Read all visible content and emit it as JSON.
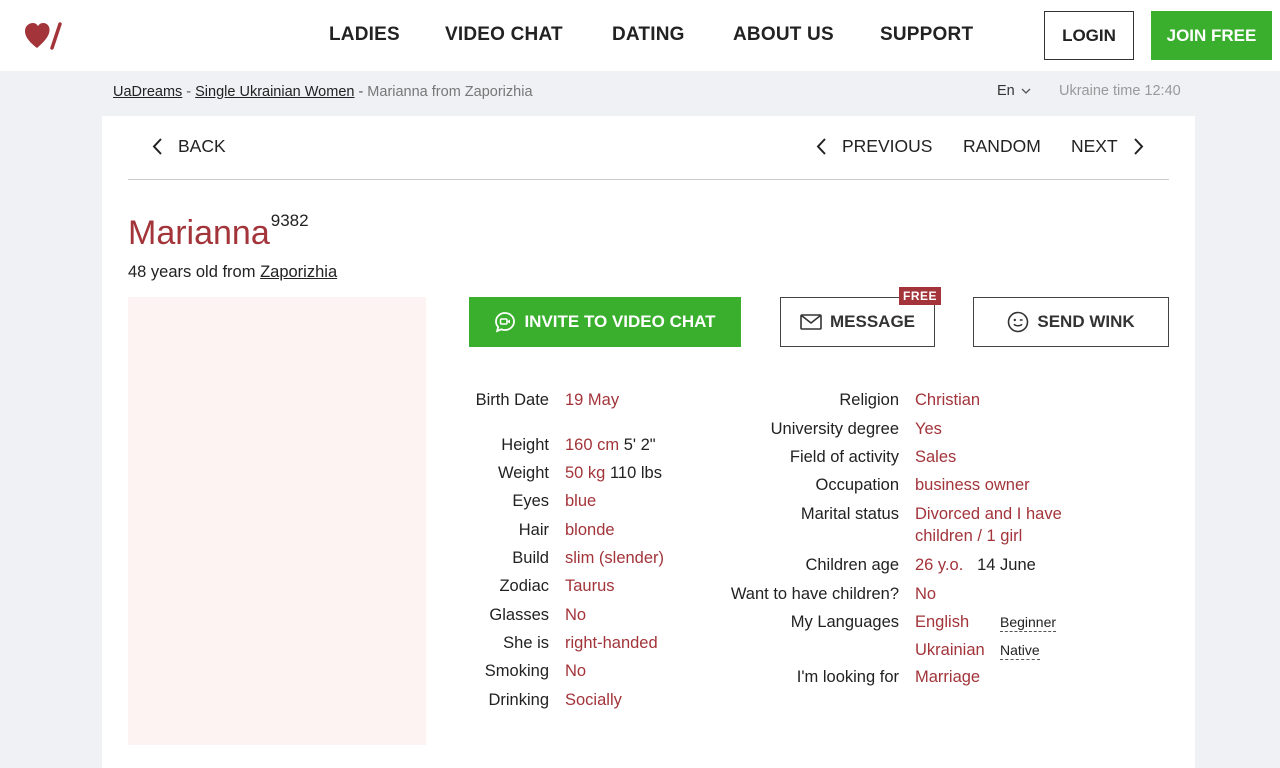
{
  "brand": {
    "logo_icon": "heart-slash-logo-icon",
    "color": "#a2343a"
  },
  "nav": {
    "items": [
      "LADIES",
      "VIDEO CHAT",
      "DATING",
      "ABOUT US",
      "SUPPORT"
    ],
    "login": "LOGIN",
    "join": "JOIN FREE"
  },
  "breadcrumb": {
    "home": "UaDreams",
    "sep": "-",
    "section": "Single Ukrainian Women",
    "current": "Marianna from Zaporizhia"
  },
  "locale": {
    "lang": "En",
    "time": "Ukraine time 12:40"
  },
  "profile_nav": {
    "back": "BACK",
    "previous": "PREVIOUS",
    "random": "RANDOM",
    "next": "NEXT"
  },
  "profile": {
    "name": "Marianna",
    "id": "9382",
    "age_text": "48 years old from",
    "city": "Zaporizhia"
  },
  "actions": {
    "video_chat": "INVITE TO VIDEO CHAT",
    "message": "MESSAGE",
    "free_badge": "FREE",
    "wink": "SEND WINK",
    "accent_green": "#3aaf2e"
  },
  "details_left": [
    {
      "label": "Birth Date",
      "value": "19 May",
      "extra": ""
    },
    {
      "label": "Height",
      "value": "160 cm",
      "extra": "5' 2\""
    },
    {
      "label": "Weight",
      "value": "50 kg",
      "extra": "110 lbs"
    },
    {
      "label": "Eyes",
      "value": "blue",
      "extra": ""
    },
    {
      "label": "Hair",
      "value": "blonde",
      "extra": ""
    },
    {
      "label": "Build",
      "value": "slim (slender)",
      "extra": ""
    },
    {
      "label": "Zodiac",
      "value": "Taurus",
      "extra": ""
    },
    {
      "label": "Glasses",
      "value": "No",
      "extra": ""
    },
    {
      "label": "She is",
      "value": "right-handed",
      "extra": ""
    },
    {
      "label": "Smoking",
      "value": "No",
      "extra": ""
    },
    {
      "label": "Drinking",
      "value": "Socially",
      "extra": ""
    }
  ],
  "details_right": {
    "religion": {
      "label": "Religion",
      "value": "Christian"
    },
    "university": {
      "label": "University degree",
      "value": "Yes"
    },
    "field": {
      "label": "Field of activity",
      "value": "Sales"
    },
    "occupation": {
      "label": "Occupation",
      "value": "business owner"
    },
    "marital": {
      "label": "Marital status",
      "value_line1": "Divorced and I have",
      "value_line2": "children / 1 girl"
    },
    "children_age": {
      "label": "Children age",
      "value": "26 y.o.",
      "extra": "14 June"
    },
    "want_children": {
      "label": "Want to have children?",
      "value": "No"
    },
    "languages": {
      "label": "My Languages",
      "items": [
        {
          "name": "English",
          "level": "Beginner"
        },
        {
          "name": "Ukrainian",
          "level": "Native"
        }
      ]
    },
    "looking_for": {
      "label": "I'm looking for",
      "value": "Marriage"
    }
  }
}
